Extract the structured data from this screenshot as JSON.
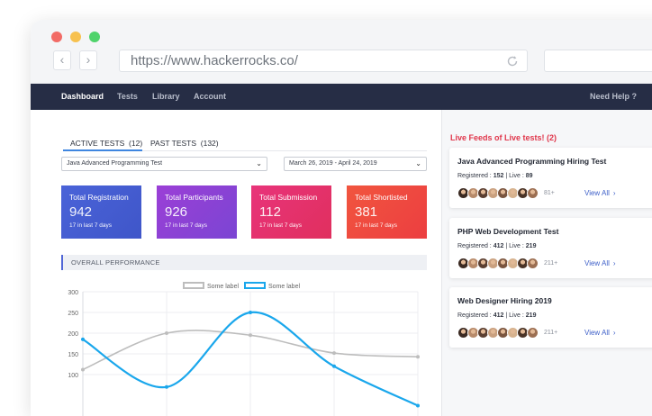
{
  "browser": {
    "url": "https://www.hackerrocks.co/",
    "back_glyph": "‹",
    "forward_glyph": "›"
  },
  "nav": {
    "items": [
      "Dashboard",
      "Tests",
      "Library",
      "Account"
    ],
    "help": "Need Help ?"
  },
  "tabs": [
    {
      "label": "ACTIVE TESTS",
      "count": "(12)"
    },
    {
      "label": "PAST TESTS",
      "count": "(132)"
    }
  ],
  "filters": {
    "test": "Java Advanced Programming Test",
    "date_range": "March 26, 2019 - April 24, 2019",
    "chevron": "⌄"
  },
  "stats": [
    {
      "title": "Total Registration",
      "value": "942",
      "sub": "17 in last 7 days",
      "color_from": "#4a63d8",
      "color_to": "#3f56c9"
    },
    {
      "title": "Total Participants",
      "value": "926",
      "sub": "17 in last 7 days",
      "color_from": "#9b3fd6",
      "color_to": "#7b45d3"
    },
    {
      "title": "Total Submission",
      "value": "112",
      "sub": "17 in last 7 days",
      "color_from": "#e8347a",
      "color_to": "#e02f5e"
    },
    {
      "title": "Total Shortisted",
      "value": "381",
      "sub": "17 in last 7 days",
      "color_from": "#f1553f",
      "color_to": "#ec3e40"
    }
  ],
  "performance_label": "OVERALL PERFORMANCE",
  "chart_data": {
    "type": "line",
    "y_ticks": [
      "300",
      "250",
      "200",
      "150",
      "100"
    ],
    "ylim": [
      50,
      300
    ],
    "x": [
      0,
      1,
      2,
      3,
      4
    ],
    "series": [
      {
        "name": "Some label",
        "color": "#bdbdbd",
        "values": [
          112,
          200,
          195,
          152,
          143
        ]
      },
      {
        "name": "Some label",
        "color": "#1aa7ec",
        "values": [
          185,
          70,
          250,
          120,
          25
        ]
      }
    ]
  },
  "feed": {
    "heading": "Live Feeds of Live tests! (2)",
    "registered_label": "Registered :",
    "live_label": "Live :",
    "separator": "|",
    "view_all": "View All",
    "arrow": "›",
    "items": [
      {
        "title": "Java Advanced Programming Hiring Test",
        "registered": "152",
        "live": "89",
        "more": "81+"
      },
      {
        "title": "PHP Web Development Test",
        "registered": "412",
        "live": "219",
        "more": "211+"
      },
      {
        "title": "Web Designer Hiring 2019",
        "registered": "412",
        "live": "219",
        "more": "211+"
      }
    ]
  },
  "avatar_colors": [
    "#3b2a22",
    "#b78a6a",
    "#5b3f31",
    "#c9a07f",
    "#7a553f",
    "#d6b28e",
    "#4a3427",
    "#9c6f52"
  ]
}
